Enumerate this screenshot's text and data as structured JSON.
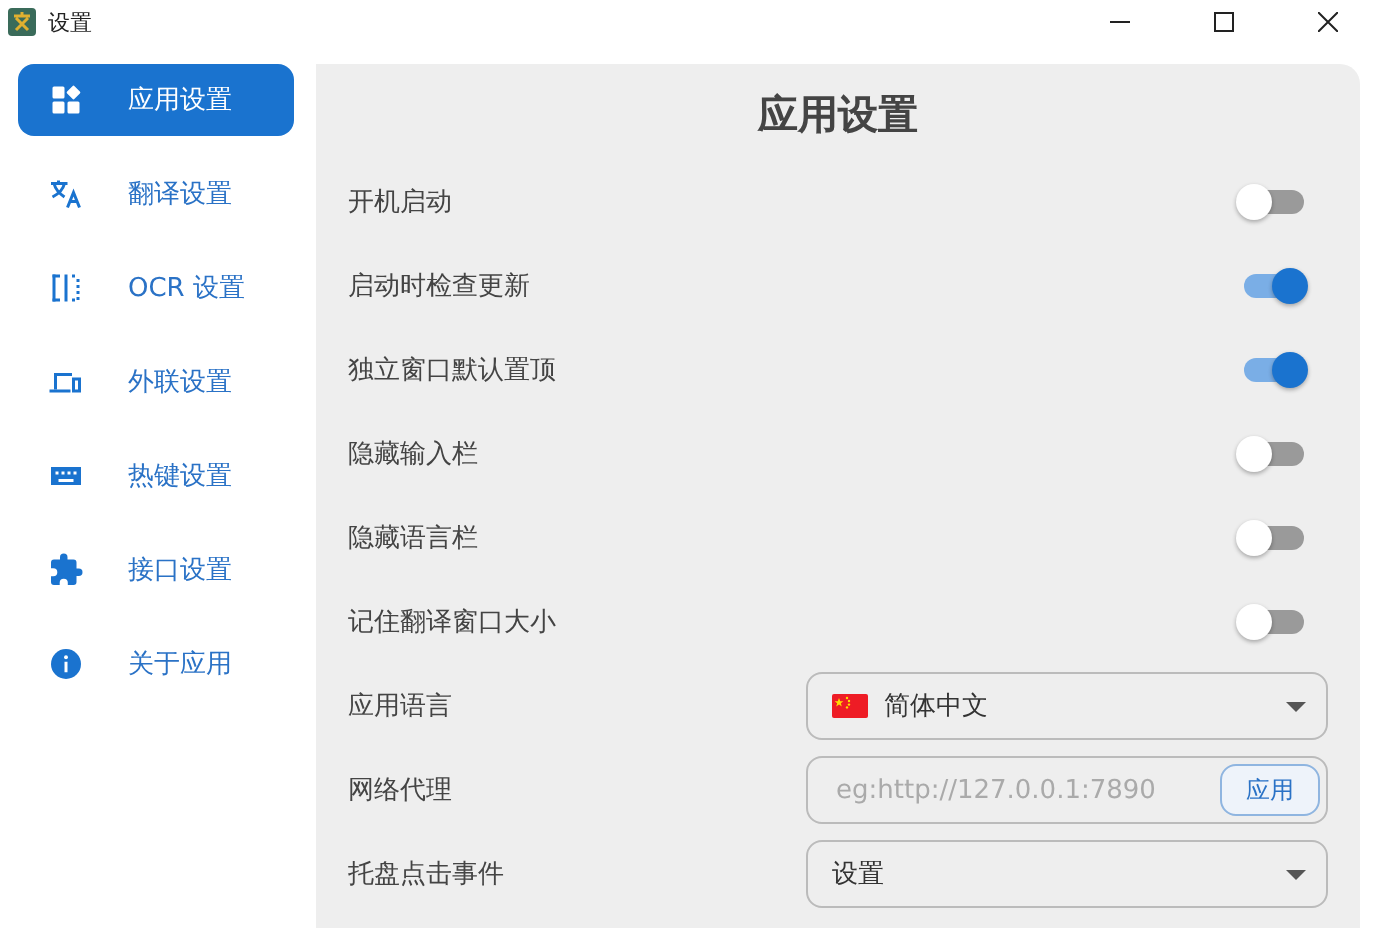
{
  "window": {
    "title": "设置"
  },
  "sidebar": {
    "items": [
      {
        "label": "应用设置",
        "selected": true
      },
      {
        "label": "翻译设置",
        "selected": false
      },
      {
        "label": "OCR 设置",
        "selected": false
      },
      {
        "label": "外联设置",
        "selected": false
      },
      {
        "label": "热键设置",
        "selected": false
      },
      {
        "label": "接口设置",
        "selected": false
      },
      {
        "label": "关于应用",
        "selected": false
      }
    ]
  },
  "panel": {
    "title": "应用设置",
    "settings": [
      {
        "kind": "switch",
        "label": "开机启动",
        "on": false
      },
      {
        "kind": "switch",
        "label": "启动时检查更新",
        "on": true
      },
      {
        "kind": "switch",
        "label": "独立窗口默认置顶",
        "on": true
      },
      {
        "kind": "switch",
        "label": "隐藏输入栏",
        "on": false
      },
      {
        "kind": "switch",
        "label": "隐藏语言栏",
        "on": false
      },
      {
        "kind": "switch",
        "label": "记住翻译窗口大小",
        "on": false
      },
      {
        "kind": "language",
        "label": "应用语言",
        "value": "简体中文"
      },
      {
        "kind": "input",
        "label": "网络代理",
        "placeholder": "eg:http://127.0.0.1:7890",
        "button": "应用"
      },
      {
        "kind": "select",
        "label": "托盘点击事件",
        "value": "设置"
      }
    ]
  }
}
